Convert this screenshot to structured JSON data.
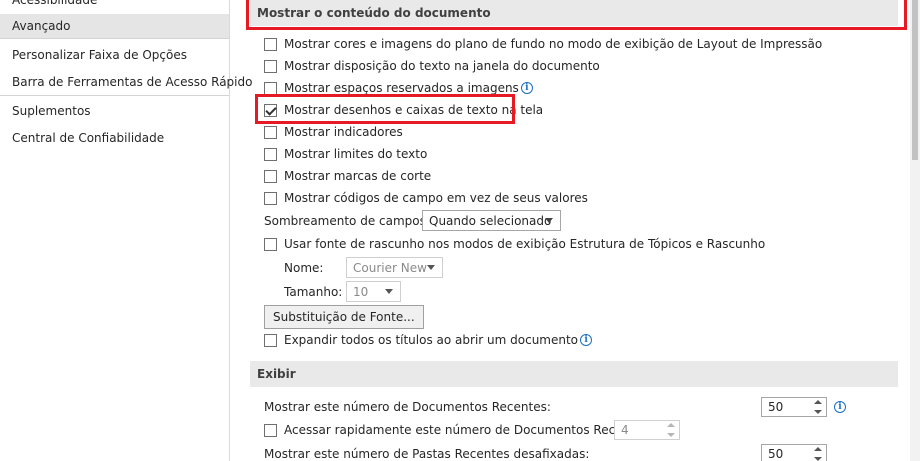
{
  "sidebar": {
    "items": [
      {
        "label": "Acessibilidade"
      },
      {
        "label": "Avançado",
        "selected": true
      },
      {
        "label": "Personalizar Faixa de Opções"
      },
      {
        "label": "Barra de Ferramentas de Acesso Rápido"
      },
      {
        "label": "Suplementos"
      },
      {
        "label": "Central de Confiabilidade"
      }
    ]
  },
  "section_document": {
    "title": "Mostrar o conteúdo do documento",
    "options": [
      {
        "label": "Mostrar cores e imagens do plano de fundo no modo de exibição de Layout de Impressão",
        "checked": false
      },
      {
        "label": "Mostrar disposição do texto na janela do documento",
        "checked": false
      },
      {
        "label": "Mostrar espaços reservados a imagens",
        "checked": false,
        "info": true
      },
      {
        "label": "Mostrar desenhos e caixas de texto na tela",
        "checked": true
      },
      {
        "label": "Mostrar indicadores",
        "checked": false
      },
      {
        "label": "Mostrar limites do texto",
        "checked": false
      },
      {
        "label": "Mostrar marcas de corte",
        "checked": false
      },
      {
        "label": "Mostrar códigos de campo em vez de seus valores",
        "checked": false
      }
    ],
    "field_shading_label": "Sombreamento de campos:",
    "field_shading_value": "Quando selecionado",
    "draft_font_label": "Usar fonte de rascunho nos modos de exibição Estrutura de Tópicos e Rascunho",
    "name_label": "Nome:",
    "name_value": "Courier New",
    "size_label": "Tamanho:",
    "size_value": "10",
    "font_substitution_button": "Substituição de Fonte...",
    "expand_headings_label": "Expandir todos os títulos ao abrir um documento"
  },
  "section_display": {
    "title": "Exibir",
    "recent_docs_label": "Mostrar este número de Documentos Recentes:",
    "recent_docs_value": "50",
    "quick_access_label": "Acessar rapidamente este número de Documentos Recentes:",
    "quick_access_value": "4",
    "recent_folders_label": "Mostrar este número de Pastas Recentes desafixadas:",
    "recent_folders_value": "50"
  },
  "colors": {
    "highlight_border": "#e51a24",
    "info_icon": "#1a6fc4",
    "selected_nav_bg": "#e5e5e5"
  }
}
